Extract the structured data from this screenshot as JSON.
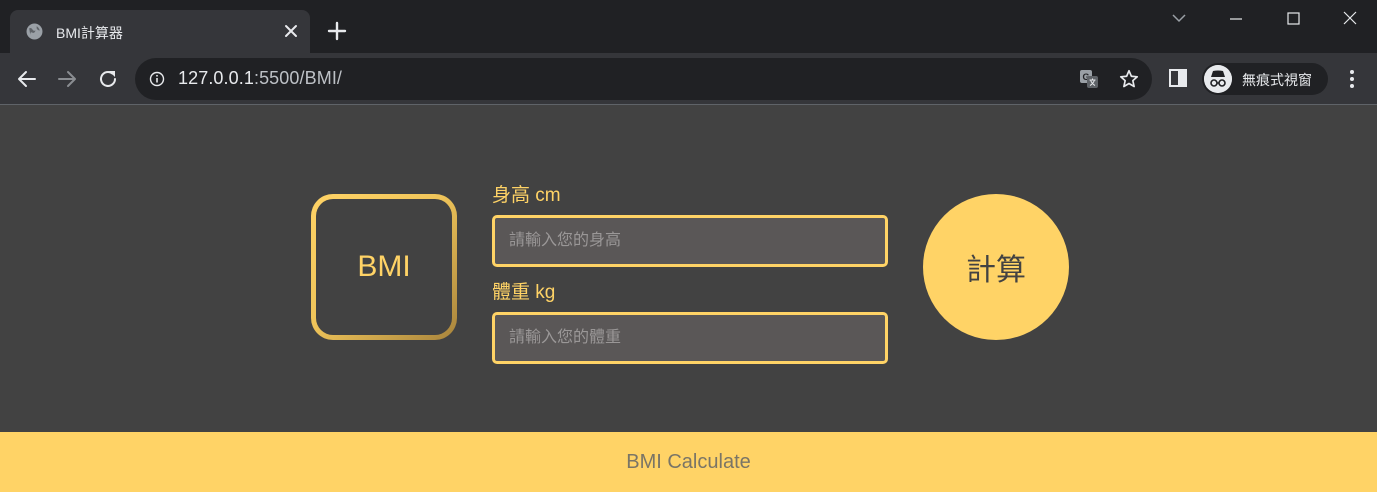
{
  "browser": {
    "tab": {
      "title": "BMI計算器",
      "favicon": "globe-icon"
    },
    "address": {
      "host": "127.0.0.1",
      "path": ":5500/BMI/"
    },
    "profile": {
      "label": "無痕式視窗",
      "icon": "incognito-icon"
    },
    "colors": {
      "frame": "#202124",
      "toolbar": "#35363a",
      "text": "#e8eaed"
    }
  },
  "page": {
    "badge": "BMI",
    "height": {
      "label": "身高 cm",
      "placeholder": "請輸入您的身高",
      "value": ""
    },
    "weight": {
      "label": "體重 kg",
      "placeholder": "請輸入您的體重",
      "value": ""
    },
    "calculate_button": "計算",
    "footer": "BMI Calculate",
    "colors": {
      "accent": "#ffd366",
      "background": "#424242",
      "input_bg": "#5a5757"
    }
  }
}
